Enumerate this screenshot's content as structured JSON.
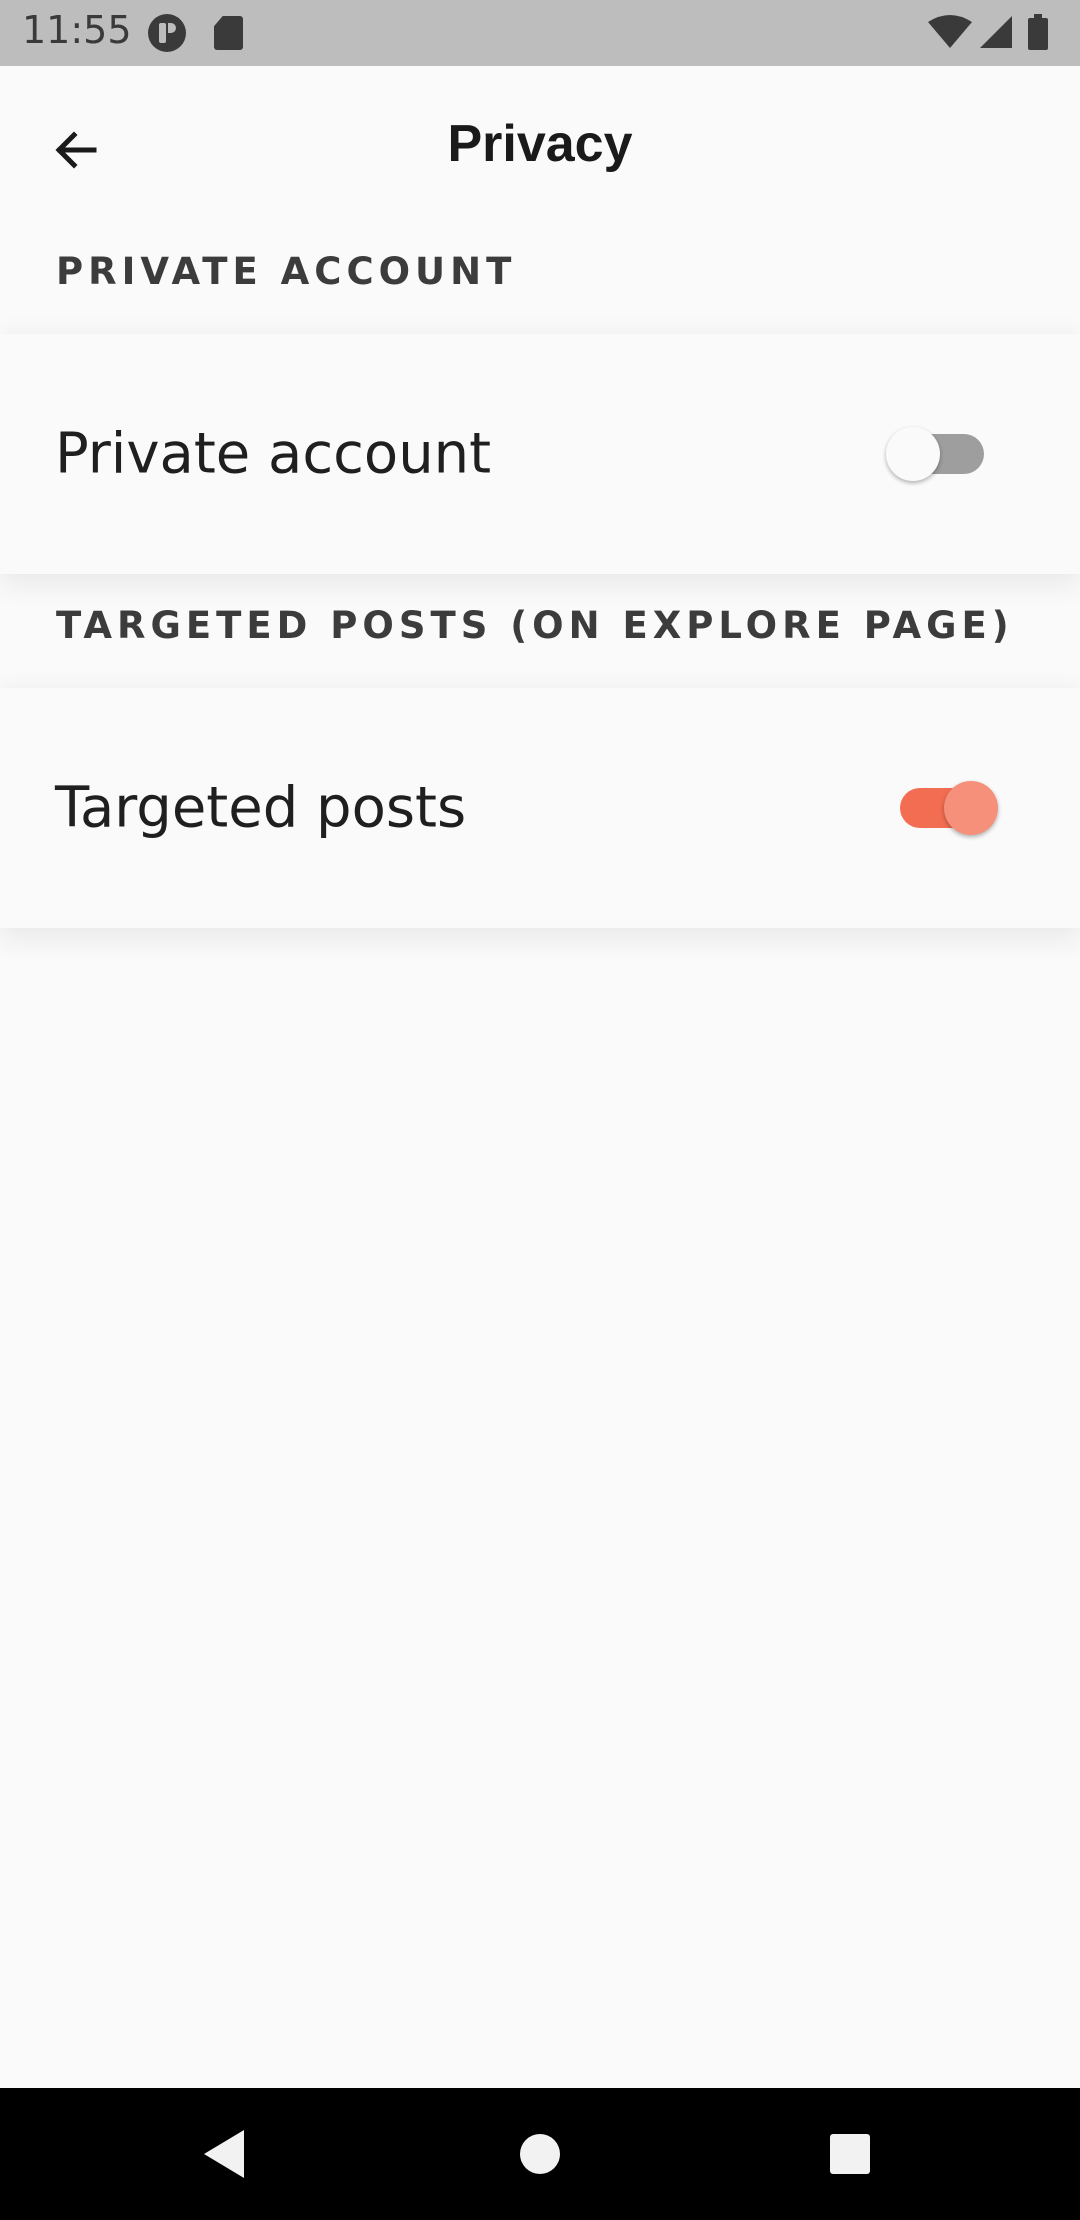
{
  "status_bar": {
    "time": "11:55",
    "icons": [
      "p-icon",
      "sd-card-icon",
      "wifi-icon",
      "cell-signal-icon",
      "battery-icon"
    ]
  },
  "app_bar": {
    "title": "Privacy",
    "back_icon": "arrow-left-icon"
  },
  "sections": [
    {
      "header": "PRIVATE ACCOUNT",
      "row": {
        "label": "Private account",
        "toggle": false
      }
    },
    {
      "header": "TARGETED POSTS (ON EXPLORE PAGE)",
      "row": {
        "label": "Targeted posts",
        "toggle": true
      }
    }
  ],
  "colors": {
    "accent": "#f26d52",
    "accent_thumb": "#f7907a",
    "background": "#fafafa",
    "status_bar": "#bdbdbd"
  },
  "nav_bar": {
    "icons": [
      "back-triangle-icon",
      "home-circle-icon",
      "recents-square-icon"
    ]
  }
}
